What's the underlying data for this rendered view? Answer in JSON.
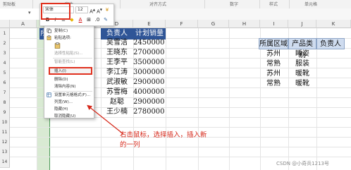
{
  "ribbon": {
    "groups": [
      "剪贴板",
      "字体",
      "对齐方式",
      "数字",
      "样式",
      "单元格"
    ]
  },
  "columns": [
    "A",
    "B",
    "C",
    "D",
    "E",
    "F",
    "G",
    "H",
    "I",
    "J",
    "K"
  ],
  "rows": [
    "1",
    "2",
    "3",
    "4",
    "5",
    "6",
    "7",
    "8",
    "9",
    "10",
    "11",
    "12",
    "13",
    "14",
    "15",
    "16"
  ],
  "mini_toolbar": {
    "font": "宋体",
    "size": "12",
    "bold": "B",
    "italic": "I",
    "font_color_glyph": "A",
    "border_glyph": "⊞"
  },
  "table": {
    "headers": [
      "负责人",
      "计划销量"
    ],
    "rows": [
      [
        "吴雪洁",
        "2450000"
      ],
      [
        "王晓东",
        "2700000"
      ],
      [
        "王李平",
        "3500000"
      ],
      [
        "李江涛",
        "3000000"
      ],
      [
        "武淑敏",
        "2900000"
      ],
      [
        "苏雪梅",
        "4000000"
      ],
      [
        "赵聪",
        "2900000"
      ],
      [
        "王少楠",
        "2780000"
      ]
    ],
    "partial_header": "所属"
  },
  "right_table": {
    "headers": [
      "所属区域",
      "产品类别",
      "负责人"
    ],
    "rows": [
      [
        "苏州",
        "睡姿"
      ],
      [
        "常熟",
        "服装"
      ],
      [
        "苏州",
        "暖靴"
      ],
      [
        "常熟",
        "暖靴"
      ]
    ]
  },
  "context_menu": {
    "items": [
      {
        "label": "剪切(T)",
        "enabled": true
      },
      {
        "label": "复制(C)",
        "enabled": true
      },
      {
        "label": "粘贴选项:",
        "enabled": true
      },
      {
        "label": "",
        "enabled": true
      },
      {
        "label": "选择性粘贴(S)...",
        "enabled": false
      },
      {
        "label": "智能查找(L)",
        "enabled": false
      },
      {
        "label": "插入(I)",
        "enabled": true
      },
      {
        "label": "删除(D)",
        "enabled": true
      },
      {
        "label": "清除内容(N)",
        "enabled": true
      },
      {
        "label": "设置单元格格式(F)...",
        "enabled": true
      },
      {
        "label": "列宽(W)...",
        "enabled": true
      },
      {
        "label": "隐藏(H)",
        "enabled": true
      },
      {
        "label": "取消隐藏(U)",
        "enabled": true
      }
    ]
  },
  "annotation": {
    "text": "右击鼠标，选择插入，插入新的一列",
    "color": "#d6281a"
  },
  "watermark": "CSDN @小奇兵1213号",
  "colors": {
    "header_blue": "#2f5597",
    "selection_green": "#d9ead3",
    "highlight_red": "#e0301e"
  }
}
